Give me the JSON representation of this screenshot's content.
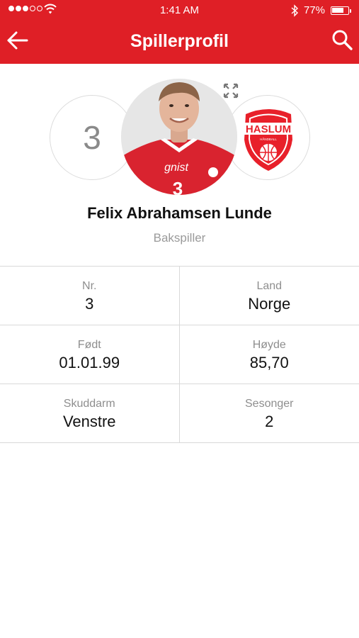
{
  "status_bar": {
    "time": "1:41 AM",
    "battery_percent": "77%",
    "battery_level": 0.77,
    "signal_bars": 3,
    "signal_total": 5
  },
  "header": {
    "title": "Spillerprofil",
    "back_icon": "arrow-left-icon",
    "search_icon": "search-icon",
    "background_color": "#df1f26"
  },
  "player": {
    "number": "3",
    "name": "Felix Abrahamsen Lunde",
    "position": "Bakspiller",
    "photo_icon": "player-photo",
    "expand_icon": "expand-icon"
  },
  "club": {
    "logo_text": "HASLUM",
    "logo_subtext": "HÅNDBALL",
    "logo_color": "#e8202a"
  },
  "stats": [
    {
      "left": {
        "label": "Nr.",
        "value": "3"
      },
      "right": {
        "label": "Land",
        "value": "Norge"
      }
    },
    {
      "left": {
        "label": "Født",
        "value": "01.01.99"
      },
      "right": {
        "label": "Høyde",
        "value": "85,70"
      }
    },
    {
      "left": {
        "label": "Skuddarm",
        "value": "Venstre"
      },
      "right": {
        "label": "Sesonger",
        "value": "2"
      }
    }
  ]
}
